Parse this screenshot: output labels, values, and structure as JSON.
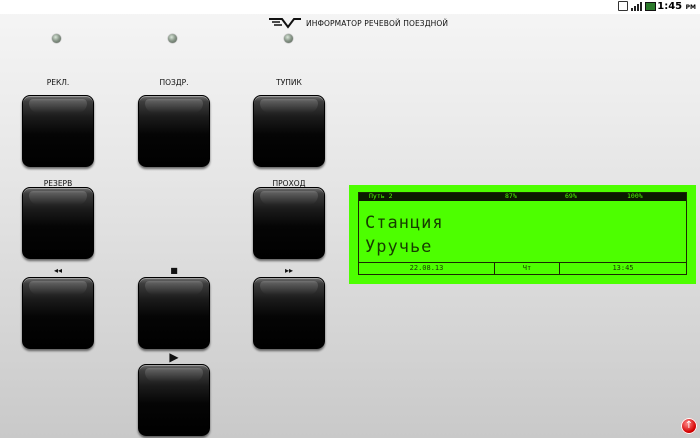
{
  "statusbar": {
    "time": "1:45",
    "ampm": "PM",
    "icons": [
      "sd-card-icon",
      "signal-icon",
      "battery-icon"
    ]
  },
  "header": {
    "title": "ИНФОРМАТОР РЕЧЕВОЙ ПОЕЗДНОЙ",
    "logo_icon": "railway-logo-icon"
  },
  "indicators": [
    "led-1",
    "led-2",
    "led-3"
  ],
  "buttons": {
    "rekl": "РЕКЛ.",
    "pozdr": "ПОЗДР.",
    "tupik": "ТУПИК",
    "rezerv": "РЕЗЕРВ",
    "prohod": "ПРОХОД",
    "rewind_glyph": "◂◂",
    "stop_glyph": "■",
    "forward_glyph": "▸▸",
    "play_glyph": "▶"
  },
  "display": {
    "track": "Путь 2",
    "level1": "87%",
    "level2": "69%",
    "level3": "100%",
    "line1": "Станция",
    "line2": "Уручье",
    "date": "22.08.13",
    "weekday": "Чт",
    "time": "13:45"
  },
  "colors": {
    "lcd_background": "#4dff00",
    "lcd_text": "#163d00",
    "fab": "#d40000"
  }
}
